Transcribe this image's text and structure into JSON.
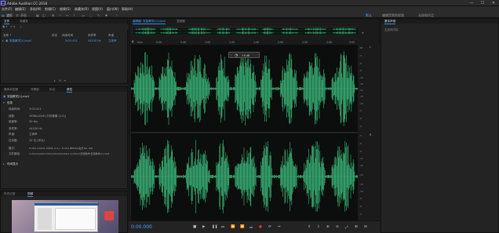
{
  "window": {
    "title": "Adobe Audition CC 2018",
    "icon_text": "Au",
    "minimize": "—",
    "maximize": "☐",
    "close": "✕"
  },
  "menu": [
    "文件(F)",
    "编辑(E)",
    "多轨(M)",
    "剪辑(C)",
    "效果(S)",
    "收藏夹(R)",
    "视图(V)",
    "窗口(W)",
    "帮助(H)"
  ],
  "toolbar": {
    "waveform_label": "波形",
    "multitrack_label": "多轨",
    "workspace": "默认",
    "workspace_menu": "编辑音频到视频",
    "radio_label": "无线电作品",
    "search_placeholder": "搜索帮助"
  },
  "files_panel": {
    "tabs": [
      "文件",
      "收藏夹"
    ],
    "columns": [
      "名称 ↑",
      "状态",
      "持续时间",
      "采样率",
      "声道"
    ],
    "file": {
      "name": "安装教学[1].mp4",
      "duration": "3:03.411",
      "sample_rate": "44100 Hz",
      "channels": "立体声"
    }
  },
  "props_panel": {
    "tabs": [
      "媒体浏览器",
      "效果组",
      "标记",
      "属性"
    ],
    "file_name": "安装教学[1].mp4",
    "section_info": "信息",
    "rows": [
      {
        "k": "持续时间:",
        "v": "3:03.411"
      },
      {
        "k": "帧数:",
        "v": "1936x1048 (方形像素 (1.0))"
      },
      {
        "k": "帧速率:",
        "v": "30 fps"
      },
      {
        "k": "采样率:",
        "v": "44100 Hz"
      },
      {
        "k": "声道:",
        "v": "立体声"
      },
      {
        "k": "位深度:",
        "v": "32 位 (浮点)"
      },
      {
        "k": "格式:",
        "v": "H.264 (1920x 1080P (1:1) ; H.264 MPEG4 格式 No. 99)"
      },
      {
        "k": "文件路径:",
        "v": "C:\\Users\\Admin\\Downloads\\Adobe Audition\\安装教学\\安装教学[1].mp4"
      }
    ],
    "section_time": "时间显示"
  },
  "history_panel": {
    "tabs": [
      "历史记录",
      "视频"
    ]
  },
  "editor": {
    "tabs": [
      "编辑器: 安装教学[1].mp4",
      "混音器"
    ],
    "ruler": [
      "hms",
      "0:20",
      "0:40",
      "1:00",
      "1:20",
      "1:40",
      "2:00",
      "2:20",
      "2:40",
      "3:00"
    ],
    "hud_gain": "+0 dB",
    "db_top": [
      "dB",
      "-3",
      "-6",
      "-9",
      "-12",
      "-15",
      "-21",
      "-15",
      "-12",
      "-9",
      "-6",
      "-3"
    ],
    "db_bottom": [
      "-3",
      "-6",
      "-9",
      "-12",
      "-15",
      "-21",
      "-15",
      "-12",
      "-9",
      "-6",
      "-3"
    ],
    "channel_L": "L",
    "channel_R": "R",
    "wave_color": "#3dbd7d"
  },
  "transport": {
    "time": "0:00.000"
  },
  "right_panel": {
    "tabs": [
      "基本声音"
    ],
    "text": "无选择内容"
  }
}
